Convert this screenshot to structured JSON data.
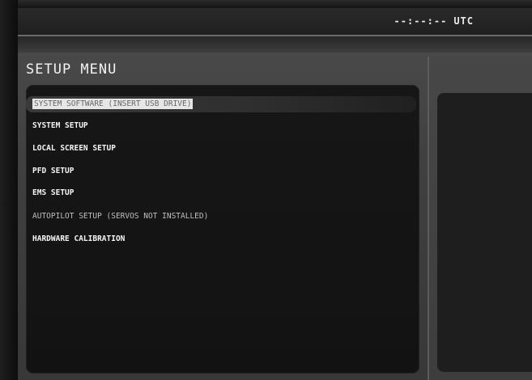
{
  "status_bar": {
    "time": "--:--:--",
    "time_unit": "UTC"
  },
  "setup_menu": {
    "title": "SETUP MENU",
    "items": [
      {
        "label": "SYSTEM SOFTWARE (INSERT USB DRIVE)",
        "state": "selected"
      },
      {
        "label": "SYSTEM SETUP",
        "state": "enabled"
      },
      {
        "label": "LOCAL SCREEN SETUP",
        "state": "enabled"
      },
      {
        "label": "PFD SETUP",
        "state": "enabled"
      },
      {
        "label": "EMS SETUP",
        "state": "enabled"
      },
      {
        "label": "AUTOPILOT SETUP (SERVOS NOT INSTALLED)",
        "state": "disabled"
      },
      {
        "label": "HARDWARE CALIBRATION",
        "state": "enabled"
      }
    ]
  },
  "colors": {
    "text": "#f4f4f4",
    "disabled_text": "#bfbfbf",
    "menu_background": "#141414",
    "frame": "#444444"
  }
}
